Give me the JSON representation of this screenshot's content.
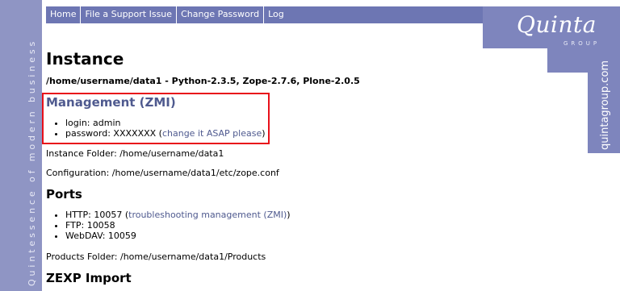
{
  "sidebar": {
    "tagline": "Quintessence of modern business"
  },
  "nav": {
    "items": [
      {
        "label": "Home"
      },
      {
        "label": "File a Support Issue"
      },
      {
        "label": "Change Password"
      },
      {
        "label": "Logout"
      }
    ]
  },
  "logo": {
    "word": "Quinta",
    "sub": "GROUP",
    "url": "quintagroup.com"
  },
  "instance": {
    "title": "Instance",
    "path_line": "/home/username/data1 - Python-2.3.5, Zope-2.7.6, Plone-2.0.5"
  },
  "management": {
    "title": "Management (ZMI)",
    "login": "login: admin",
    "password_prefix": "password: XXXXXXX (",
    "change_link": "change it ASAP please",
    "password_suffix": ")"
  },
  "instance_folder": "Instance Folder: /home/username/data1",
  "configuration": "Configuration: /home/username/data1/etc/zope.conf",
  "ports": {
    "title": "Ports",
    "http_prefix": "HTTP: 10057 (",
    "http_link": "troubleshooting management (ZMI)",
    "http_suffix": ")",
    "ftp": "FTP: 10058",
    "webdav": "WebDAV: 10059"
  },
  "products_folder": "Products Folder: /home/username/data1/Products",
  "zexp": {
    "title": "ZEXP Import"
  }
}
